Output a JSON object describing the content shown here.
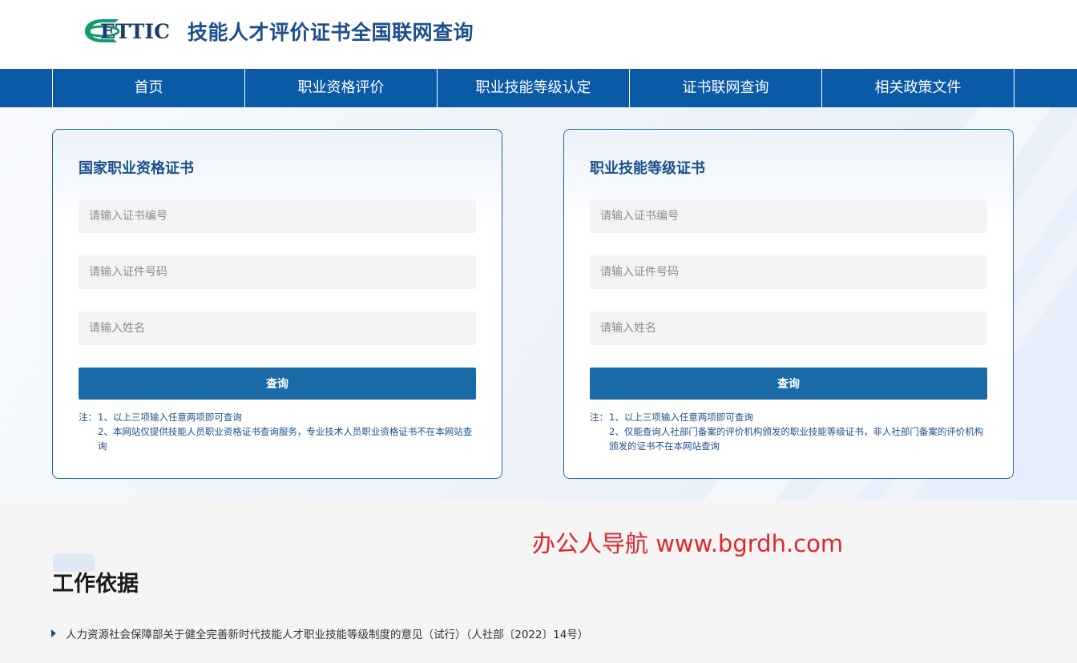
{
  "header": {
    "logo_text": "ETTIC",
    "title": "技能人才评价证书全国联网查询"
  },
  "nav": {
    "items": [
      {
        "label": "首页"
      },
      {
        "label": "职业资格评价"
      },
      {
        "label": "职业技能等级认定"
      },
      {
        "label": "证书联网查询"
      },
      {
        "label": "相关政策文件"
      }
    ]
  },
  "cards": [
    {
      "title": "国家职业资格证书",
      "cert_placeholder": "请输入证书编号",
      "id_placeholder": "请输入证件号码",
      "name_placeholder": "请输入姓名",
      "button": "查询",
      "note_prefix": "注：",
      "note_1": "1、以上三项输入任意两项即可查询",
      "note_2": "2、本网站仅提供技能人员职业资格证书查询服务，专业技术人员职业资格证书不在本网站查询"
    },
    {
      "title": "职业技能等级证书",
      "cert_placeholder": "请输入证书编号",
      "id_placeholder": "请输入证件号码",
      "name_placeholder": "请输入姓名",
      "button": "查询",
      "note_prefix": "注：",
      "note_1": "1、以上三项输入任意两项即可查询",
      "note_2": "2、仅能查询人社部门备案的评价机构颁发的职业技能等级证书，非人社部门备案的评价机构颁发的证书不在本网站查询"
    }
  ],
  "watermark": "办公人导航 www.bgrdh.com",
  "basis": {
    "title": "工作依据",
    "items": [
      {
        "label": "人力资源社会保障部关于健全完善新时代技能人才职业技能等级制度的意见（试行）（人社部〔2022〕14号）"
      }
    ]
  },
  "colors": {
    "nav_bg": "#0a5aa8",
    "brand_text": "#1c4f8c",
    "button_bg": "#1a6aa8",
    "logo_green": "#129b71",
    "watermark": "#e0262b"
  },
  "icons": {
    "logo": "ettic-logo",
    "list_marker": "triangle-right-icon"
  }
}
